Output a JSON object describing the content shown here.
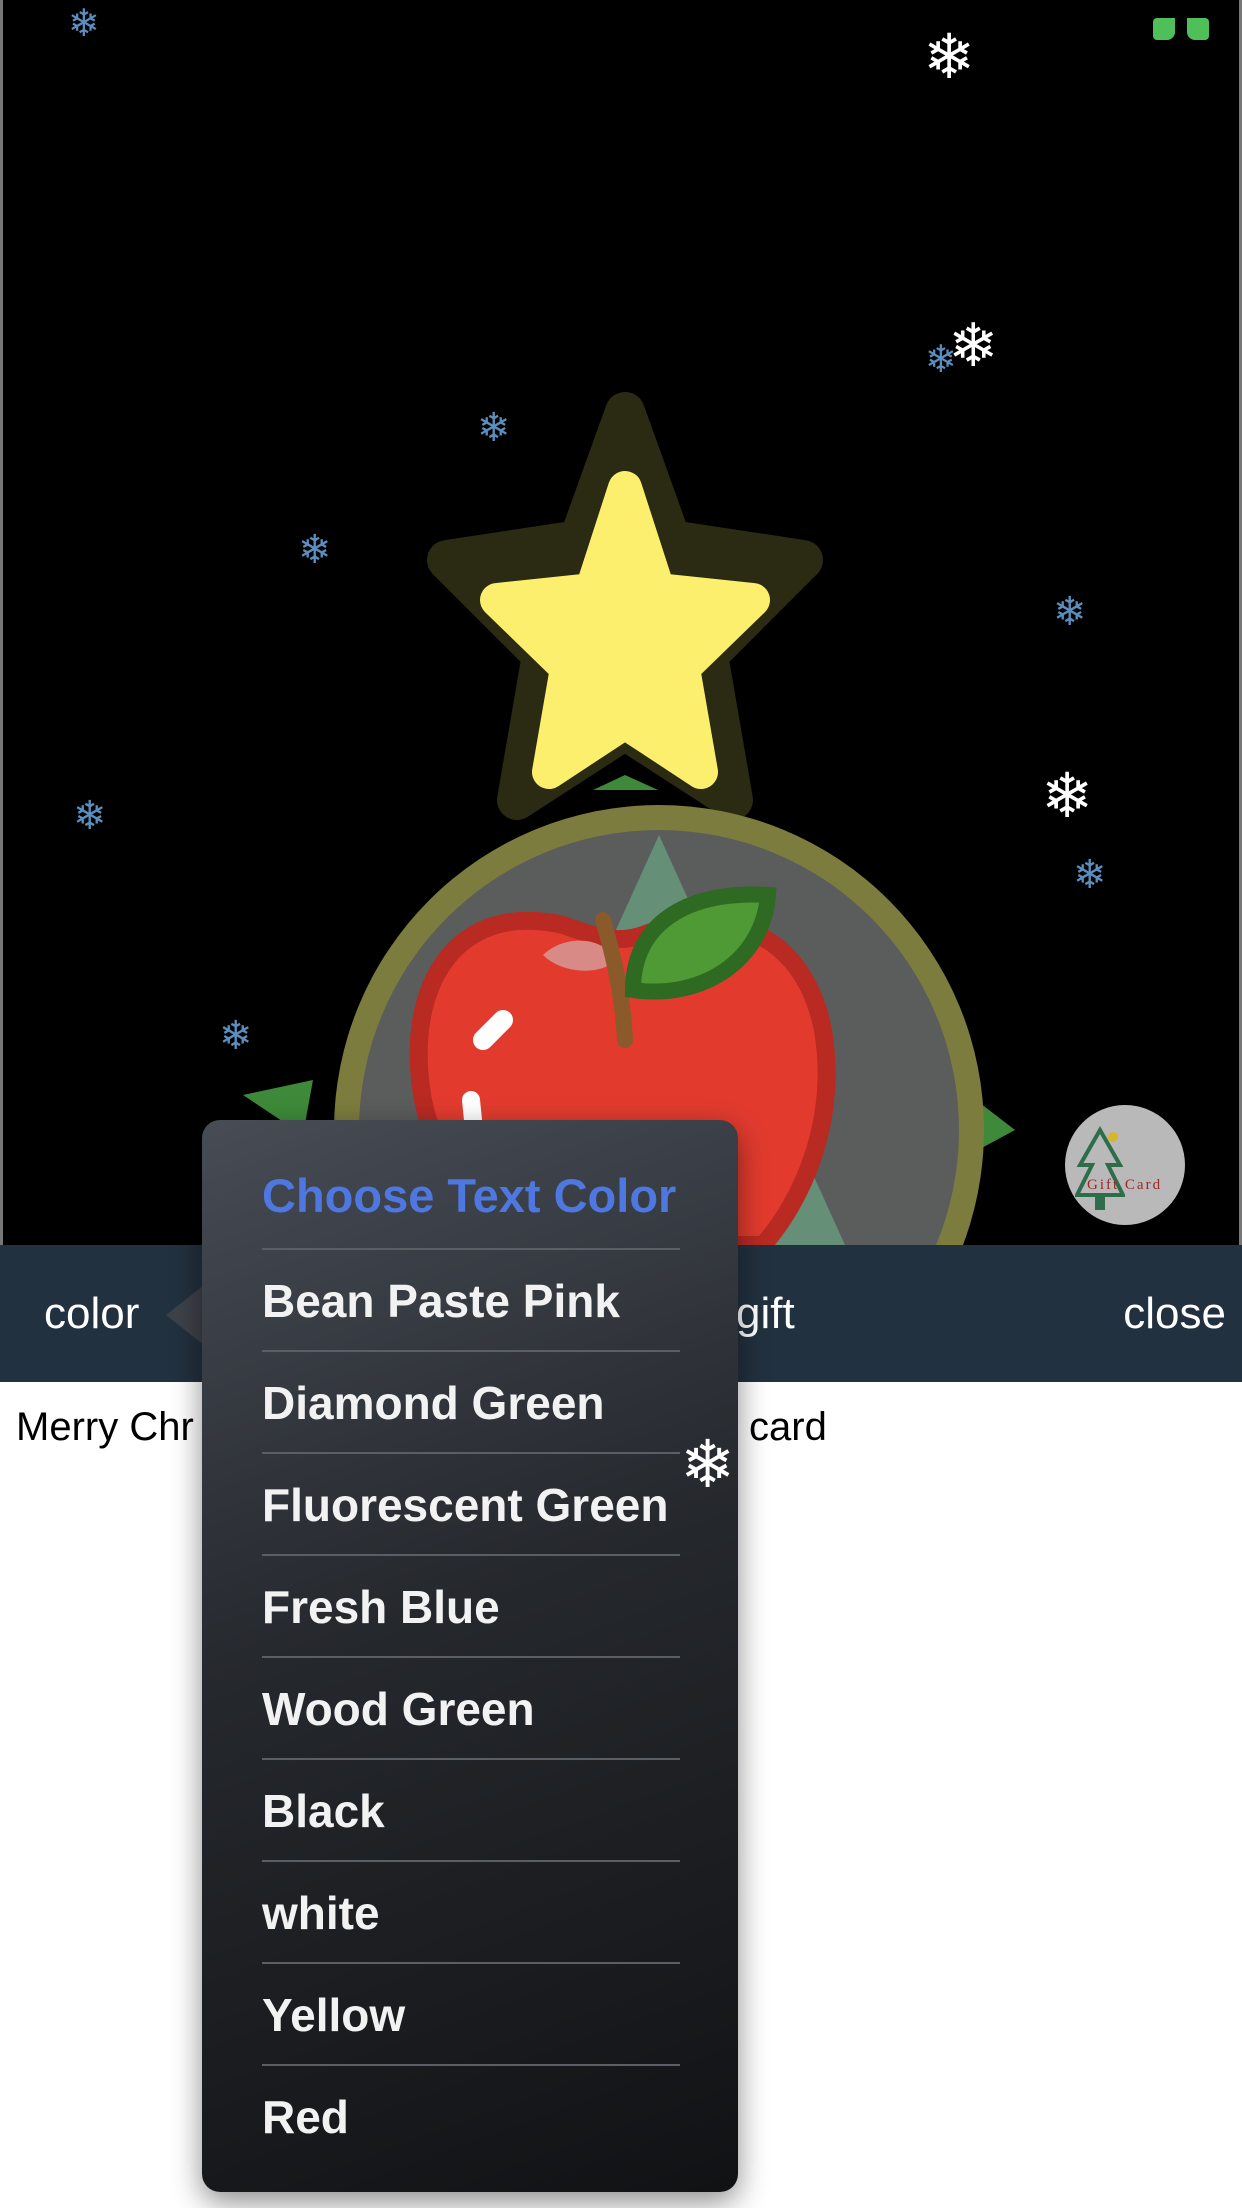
{
  "toolbar": {
    "color_label": "color",
    "gift_label": "gift",
    "close_label": "close"
  },
  "card_text": {
    "left": "Merry Chr",
    "right": "card"
  },
  "gift_badge": {
    "label": "Gift Card"
  },
  "color_menu": {
    "title": "Choose Text Color",
    "items": [
      "Bean Paste Pink",
      "Diamond Green",
      "Fluorescent Green",
      "Fresh Blue",
      "Wood Green",
      "Black",
      "white",
      "Yellow",
      "Red"
    ]
  },
  "colors": {
    "toolbar_bg": "#22313f",
    "menu_title": "#4f77e0",
    "star": "#fdef6e",
    "apple": "#e23b2e",
    "leaf": "#4f9a35"
  },
  "icons": {
    "fullscreen": "fullscreen-icon",
    "snowflake": "snowflake-icon"
  }
}
